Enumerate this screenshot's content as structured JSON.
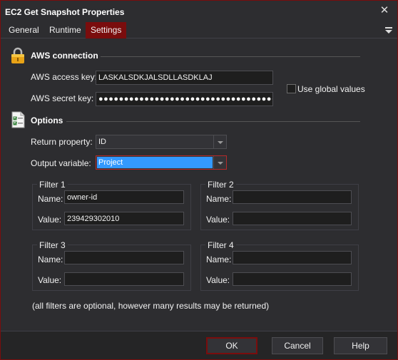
{
  "window": {
    "title": "EC2 Get Snapshot Properties"
  },
  "tabs": [
    {
      "label": "General",
      "active": false
    },
    {
      "label": "Runtime",
      "active": false
    },
    {
      "label": "Settings",
      "active": true
    }
  ],
  "aws": {
    "section_title": "AWS connection",
    "access_key_label": "AWS access key:",
    "access_key_value": "LASKALSDKJALSDLLASDKLAJ",
    "secret_key_label": "AWS secret key:",
    "secret_key_value": "●●●●●●●●●●●●●●●●●●●●●●●●●●●●●●●●●●●●●●●●●●",
    "use_global_label": "Use global values",
    "use_global_checked": false
  },
  "options": {
    "section_title": "Options",
    "return_property_label": "Return property:",
    "return_property_value": "ID",
    "output_variable_label": "Output variable:",
    "output_variable_value": "Project"
  },
  "filters": [
    {
      "title": "Filter 1",
      "name_label": "Name:",
      "name_value": "owner-id",
      "value_label": "Value:",
      "value_value": "239429302010"
    },
    {
      "title": "Filter 2",
      "name_label": "Name:",
      "name_value": "",
      "value_label": "Value:",
      "value_value": ""
    },
    {
      "title": "Filter 3",
      "name_label": "Name:",
      "name_value": "",
      "value_label": "Value:",
      "value_value": ""
    },
    {
      "title": "Filter 4",
      "name_label": "Name:",
      "name_value": "",
      "value_label": "Value:",
      "value_value": ""
    }
  ],
  "note": "(all filters are optional, however many results may be returned)",
  "buttons": {
    "ok": "OK",
    "cancel": "Cancel",
    "help": "Help"
  },
  "colors": {
    "accent": "#7a0d0d",
    "selection": "#3399ff",
    "background": "#2d2d30"
  }
}
